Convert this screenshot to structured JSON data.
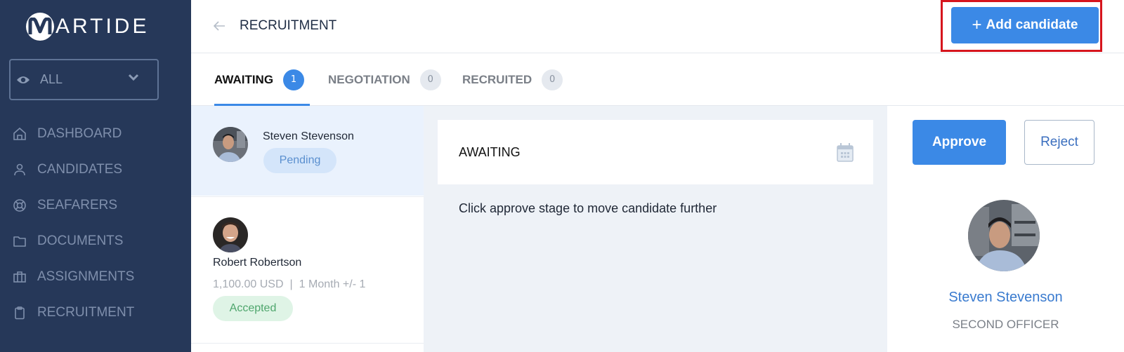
{
  "app": {
    "logo_text": "ARTIDE",
    "logo_letter": "M",
    "colors": {
      "sidebar_bg": "#263859",
      "accent": "#3b89e6",
      "highlight_frame": "#d6151d",
      "pending_bg": "#d4e5fa",
      "accepted_bg": "#dff4e6"
    }
  },
  "sidebar": {
    "filter": {
      "icon": "eye-icon",
      "value": "ALL"
    },
    "items": [
      {
        "label": "DASHBOARD",
        "icon": "home-icon"
      },
      {
        "label": "CANDIDATES",
        "icon": "user-icon"
      },
      {
        "label": "SEAFARERS",
        "icon": "lifebuoy-icon"
      },
      {
        "label": "DOCUMENTS",
        "icon": "folder-icon"
      },
      {
        "label": "ASSIGNMENTS",
        "icon": "briefcase-icon"
      },
      {
        "label": "RECRUITMENT",
        "icon": "clipboard-icon"
      }
    ]
  },
  "header": {
    "title": "RECRUITMENT",
    "add_button": "Add candidate",
    "add_button_icon": "+"
  },
  "tabs": [
    {
      "label": "AWAITING",
      "count": "1",
      "active": true
    },
    {
      "label": "NEGOTIATION",
      "count": "0",
      "active": false
    },
    {
      "label": "RECRUITED",
      "count": "0",
      "active": false
    }
  ],
  "candidates": [
    {
      "name": "Steven Stevenson",
      "status": "Pending",
      "selected": true
    },
    {
      "name": "Robert Robertson",
      "salary": "1,100.00 USD",
      "separator": "|",
      "duration": "1 Month +/- 1",
      "status": "Accepted",
      "selected": false
    }
  ],
  "stage": {
    "title": "AWAITING",
    "hint": "Click approve stage to move candidate further"
  },
  "detail": {
    "approve_label": "Approve",
    "reject_label": "Reject",
    "name": "Steven Stevenson",
    "role": "SECOND OFFICER"
  }
}
